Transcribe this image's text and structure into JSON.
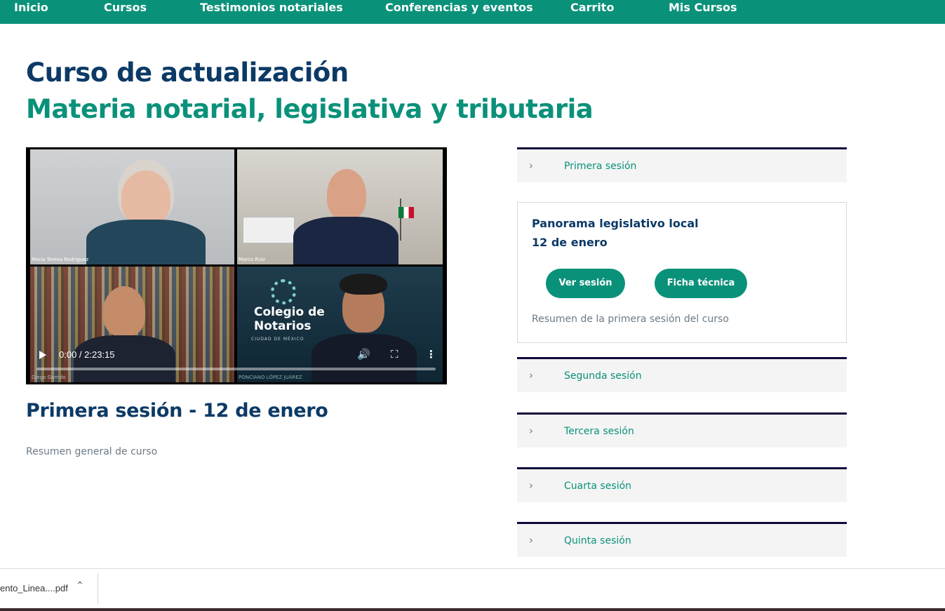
{
  "nav": {
    "items": [
      "Inicio",
      "Cursos",
      "Testimonios notariales",
      "Conferencias y eventos",
      "Carrito",
      "Mis Cursos"
    ],
    "bg_color": "#0a917a"
  },
  "course": {
    "title_line1": "Curso de actualización",
    "title_line2": "Materia notarial, legislativa y tributaria"
  },
  "video": {
    "participants": [
      "Maria Teresa Rodriguez",
      "Marco Ruiz",
      "Diego Garrido",
      "PONCIANO LÓPEZ JUÁREZ"
    ],
    "logo_line1": "Colegio de",
    "logo_line2": "Notarios",
    "logo_sub": "CIUDAD DE MÉXICO",
    "time": "0:00 / 2:23:15",
    "progress": 0
  },
  "session": {
    "heading": "Primera sesión - 12 de enero",
    "summary": "Resumen general de curso"
  },
  "accordion": [
    {
      "label": "Primera sesión"
    },
    {
      "label": "Segunda sesión"
    },
    {
      "label": "Tercera sesión"
    },
    {
      "label": "Cuarta sesión"
    },
    {
      "label": "Quinta sesión"
    }
  ],
  "panel": {
    "title": "Panorama legislativo local",
    "date": "12 de enero",
    "btn_view": "Ver sesión",
    "btn_sheet": "Ficha técnica",
    "description": "Resumen de la primera sesión del curso"
  },
  "downloads": {
    "file": "ento_Linea....pdf"
  },
  "colors": {
    "primary": "#0a917a",
    "navy": "#0c3a66"
  }
}
